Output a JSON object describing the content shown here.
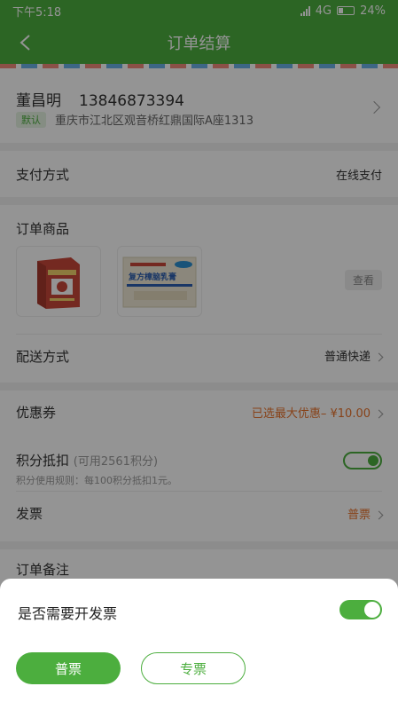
{
  "status_bar": {
    "time": "下午5:18",
    "network": "4G",
    "battery": "24%"
  },
  "navbar": {
    "title": "订单结算"
  },
  "address": {
    "name": "董昌明",
    "phone": "13846873394",
    "tag": "默认",
    "detail": "重庆市江北区观音桥红鼎国际A座1313"
  },
  "payment": {
    "label": "支付方式",
    "value": "在线支付"
  },
  "goods": {
    "label": "订单商品",
    "products": [
      {
        "name": "product-1",
        "box_text": "",
        "color": "#c9473a"
      },
      {
        "name": "product-2",
        "box_text": "复方樟脑乳膏",
        "color": "#2b5db0"
      }
    ],
    "view_label": "查看"
  },
  "shipping": {
    "label": "配送方式",
    "value": "普通快递"
  },
  "coupon": {
    "label": "优惠券",
    "value": "已选最大优惠– ¥10.00"
  },
  "points": {
    "label": "积分抵扣",
    "available": "(可用2561积分)",
    "rule": "积分使用规则：每100积分抵扣1元。"
  },
  "invoice": {
    "label": "发票",
    "value": "普票"
  },
  "remark": {
    "label": "订单备注"
  },
  "sheet": {
    "question": "是否需要开发票",
    "btn_normal": "普票",
    "btn_special": "专票"
  },
  "colors": {
    "brand": "#4cae3e",
    "accent_orange": "#e9732b"
  }
}
